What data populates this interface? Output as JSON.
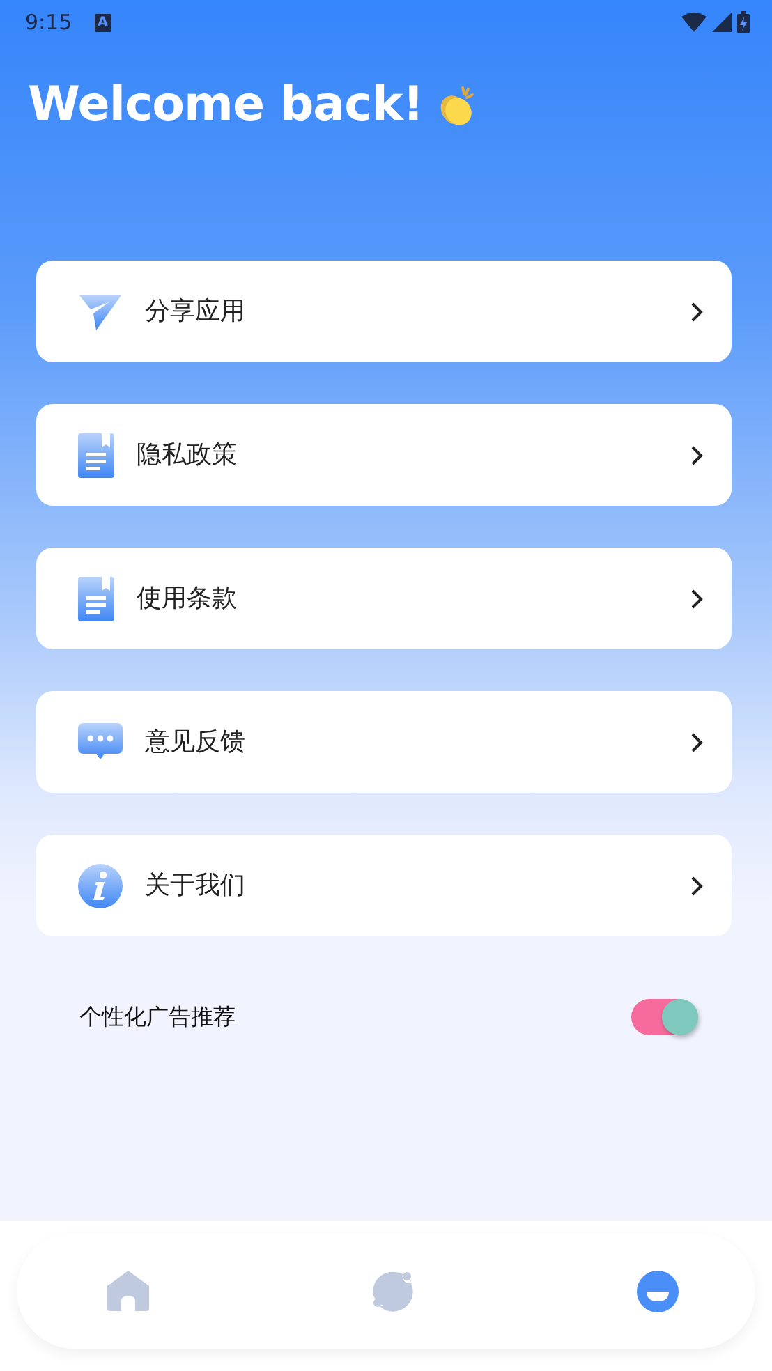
{
  "status_bar": {
    "time": "9:15",
    "notification_glyph": "A"
  },
  "title": "Welcome back!",
  "menu": [
    {
      "label": "分享应用",
      "kind": "share"
    },
    {
      "label": "隐私政策",
      "kind": "document"
    },
    {
      "label": "使用条款",
      "kind": "document"
    },
    {
      "label": "意见反馈",
      "kind": "feedback"
    },
    {
      "label": "关于我们",
      "kind": "info"
    }
  ],
  "setting": {
    "label": "个性化广告推荐",
    "on": true
  },
  "bottom_nav": [
    {
      "kind": "home",
      "selected": false
    },
    {
      "kind": "discover",
      "selected": false
    },
    {
      "kind": "profile",
      "selected": true
    }
  ]
}
